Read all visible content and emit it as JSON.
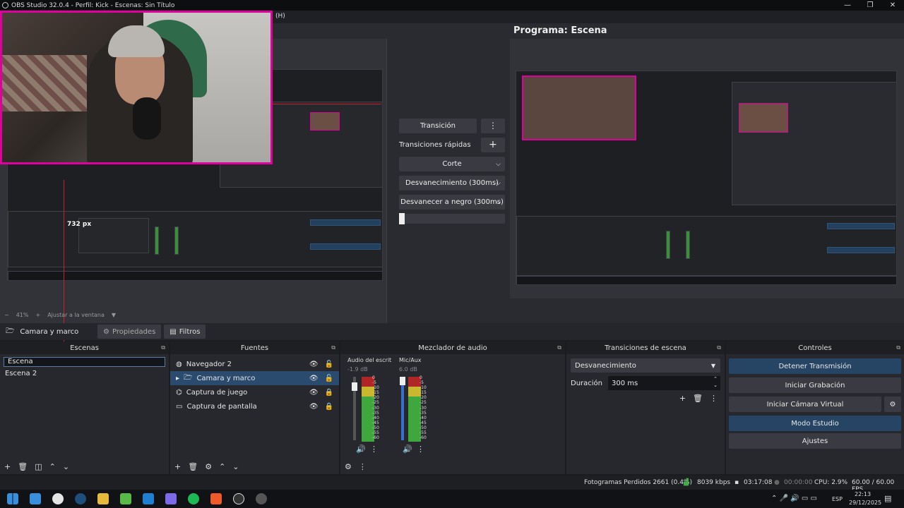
{
  "window": {
    "title": "OBS Studio 32.0.4 - Perfil: Kick - Escenas: Sin Título",
    "menu_fragment": "(H)",
    "buttons": [
      "—",
      "❐",
      "✕"
    ]
  },
  "studio": {
    "program_title": "Programa: Escena",
    "ruler_label": "732 px",
    "zoom_minus": "−",
    "zoom_level": "41%",
    "zoom_plus": "+",
    "zoom_fit": "Ajustar a la ventana",
    "zoom_menu": "▼"
  },
  "transition_panel": {
    "transition_button": "Transición",
    "quick_label": "Transiciones rápidas",
    "quick": [
      "Corte",
      "Desvanecimiento (300ms)",
      "Desvanecer a negro (300ms)"
    ],
    "slider_value": 0
  },
  "context_bar": {
    "source_name": "Camara y marco",
    "properties_tab": "Propiedades",
    "filters_tab": "Filtros"
  },
  "scenes": {
    "title": "Escenas",
    "editing_value": "Escena",
    "items": [
      "Escena 2"
    ]
  },
  "sources": {
    "title": "Fuentes",
    "items": [
      {
        "name": "Navegador 2",
        "icon": "globe-icon"
      },
      {
        "name": "Camara y marco",
        "icon": "folder-icon",
        "selected": true
      },
      {
        "name": "Captura de juego",
        "icon": "gamepad-icon"
      },
      {
        "name": "Captura de pantalla",
        "icon": "monitor-icon"
      }
    ]
  },
  "mixer": {
    "title": "Mezclador de audio",
    "channels": [
      {
        "name": "Audio del escrit",
        "db": "-1.9 dB",
        "fader": 0.9
      },
      {
        "name": "Mic/Aux",
        "db": "6.0 dB",
        "fader": 1.0
      }
    ],
    "scale": [
      "0",
      "-5",
      "-10",
      "-15",
      "-20",
      "-25",
      "-30",
      "-35",
      "-40",
      "-45",
      "-50",
      "-55",
      "-60"
    ]
  },
  "scene_transitions": {
    "title": "Transiciones de escena",
    "selected": "Desvanecimiento",
    "duration_label": "Duración",
    "duration_value": "300 ms"
  },
  "controls": {
    "title": "Controles",
    "buttons": [
      "Detener Transmisión",
      "Iniciar Grabación",
      "Iniciar Cámara Virtual",
      "Modo Estudio",
      "Ajustes"
    ]
  },
  "status": {
    "dropped": "Fotogramas Perdidos 2661 (0.4%)",
    "bitrate": "8039 kbps",
    "stream_time": "03:17:08",
    "rec_time": "00:00:00",
    "cpu": "CPU: 2.9%",
    "fps": "60.00 / 60.00 FPS"
  },
  "taskbar": {
    "lang": "ESP",
    "time": "22:13",
    "date": "29/12/2025"
  },
  "colors": {
    "accent_blue": "#264565",
    "selection": "#2a4a6e",
    "camera_border": "#e000a0",
    "ruler_red": "#d01c2a"
  }
}
